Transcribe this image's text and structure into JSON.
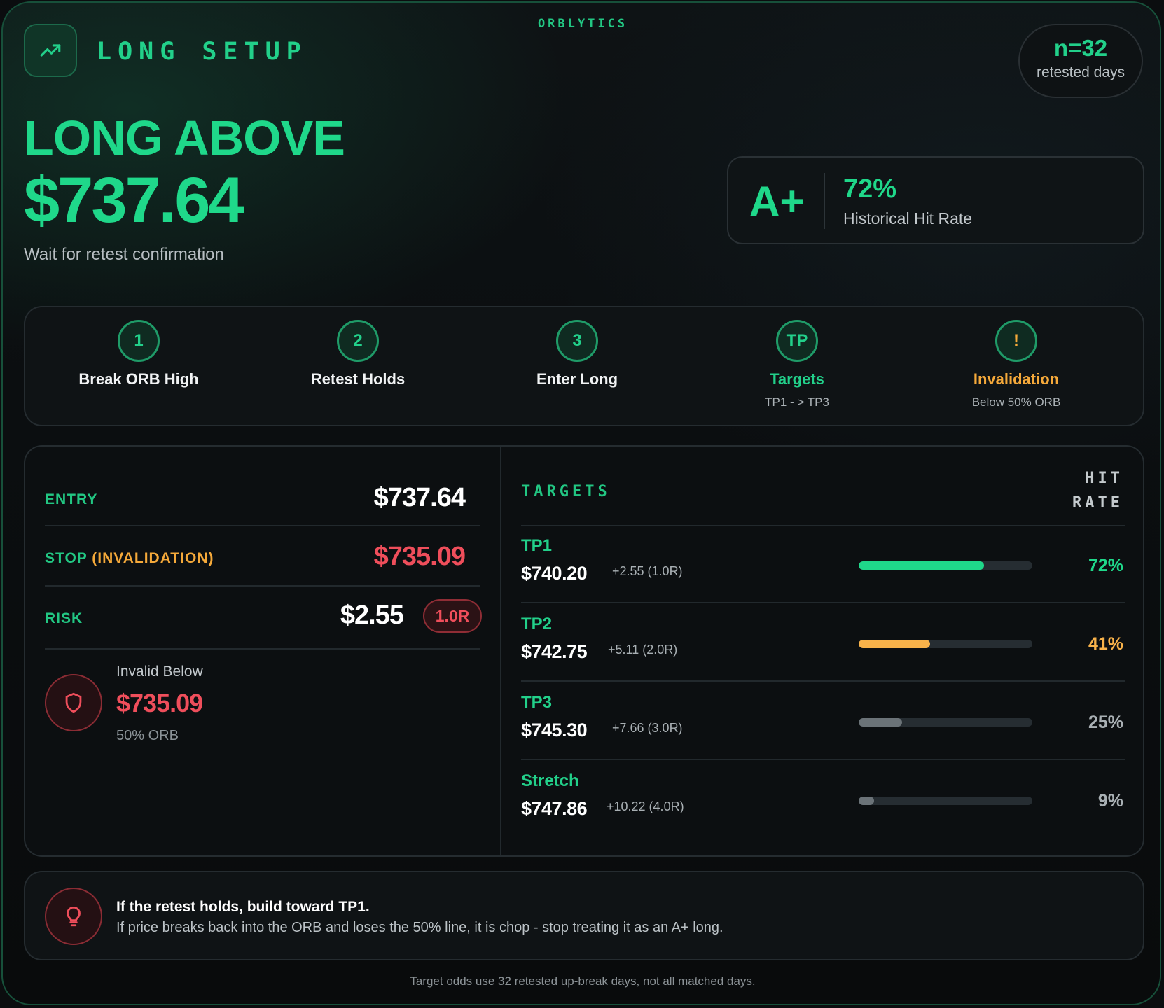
{
  "brand": "ORBLYTICS",
  "header": {
    "setup_label": "LONG SETUP",
    "trend_icon": "trending-up-icon",
    "sample_value": "n=32",
    "sample_label": "retested days"
  },
  "hero": {
    "headline": "LONG ABOVE",
    "price": "$737.64",
    "subline": "Wait for retest confirmation"
  },
  "grade": {
    "grade": "A+",
    "hit_rate": "72%",
    "hit_rate_label": "Historical Hit Rate"
  },
  "steps": [
    {
      "marker": "1",
      "title": "Break ORB High",
      "sub": ""
    },
    {
      "marker": "2",
      "title": "Retest Holds",
      "sub": ""
    },
    {
      "marker": "3",
      "title": "Enter Long",
      "sub": ""
    },
    {
      "marker": "TP",
      "title": "Targets",
      "sub": "TP1 - > TP3"
    },
    {
      "marker": "!",
      "title": "Invalidation",
      "sub": "Below 50% ORB"
    }
  ],
  "trade": {
    "entry_label": "ENTRY",
    "entry_value": "$737.64",
    "stop_label": "STOP",
    "stop_label_suffix": "(INVALIDATION)",
    "stop_value": "$735.09",
    "risk_label": "RISK",
    "risk_value": "$2.55",
    "risk_badge": "1.0R",
    "invalid_label": "Invalid Below",
    "invalid_value": "$735.09",
    "invalid_sub": "50% ORB"
  },
  "targets": {
    "heading": "TARGETS",
    "hit_heading_1": "HIT",
    "hit_heading_2": "RATE",
    "items": [
      {
        "name": "TP1",
        "price": "$740.20",
        "delta": "+2.55 (1.0R)",
        "hit": "72%",
        "hit_fraction": 0.72,
        "color": "#1fd88a"
      },
      {
        "name": "TP2",
        "price": "$742.75",
        "delta": "+5.11 (2.0R)",
        "hit": "41%",
        "hit_fraction": 0.41,
        "color": "#f8b24a"
      },
      {
        "name": "TP3",
        "price": "$745.30",
        "delta": "+7.66 (3.0R)",
        "hit": "25%",
        "hit_fraction": 0.25,
        "color": "#6b7378"
      },
      {
        "name": "Stretch",
        "price": "$747.86",
        "delta": "+10.22 (4.0R)",
        "hit": "9%",
        "hit_fraction": 0.09,
        "color": "#6b7378"
      }
    ]
  },
  "tip": {
    "title": "If the retest holds, build toward TP1.",
    "body": "If price breaks back into the ORB and loses the 50% line, it is chop - stop treating it as an A+ long."
  },
  "footnote": "Target odds use 32 retested up-break days, not all matched days.",
  "colors": {
    "accent_green": "#1fd88a",
    "warn_orange": "#f5a93a",
    "danger_red": "#ef4e5b"
  }
}
